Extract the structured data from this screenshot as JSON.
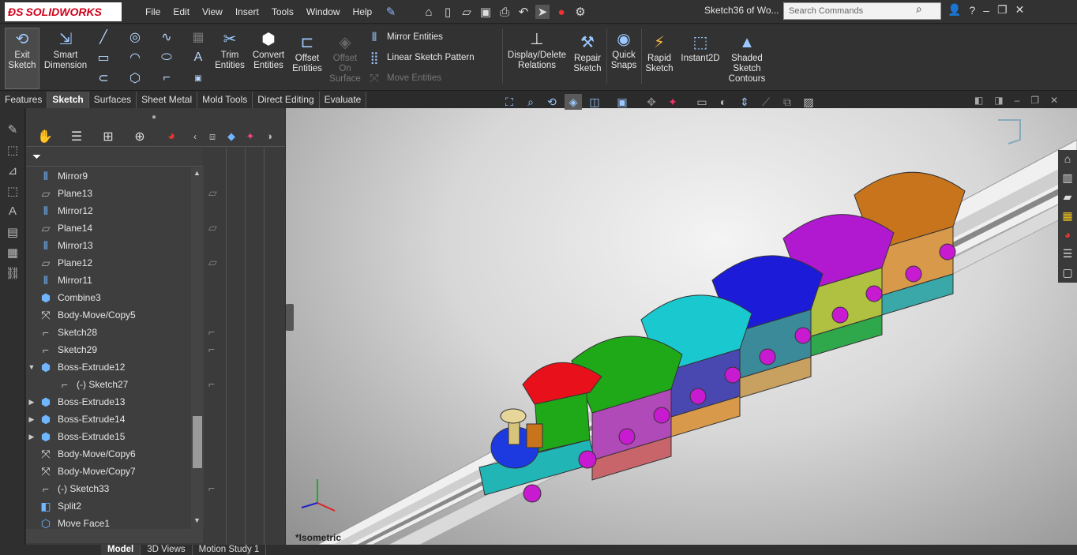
{
  "app": {
    "brand": "SOLIDWORKS",
    "menus": [
      "File",
      "Edit",
      "View",
      "Insert",
      "Tools",
      "Window",
      "Help"
    ],
    "doc_title": "Sketch36 of Wo...",
    "search_placeholder": "Search Commands"
  },
  "commands": {
    "exit_sketch": "Exit Sketch",
    "smart_dimension": "Smart Dimension",
    "trim_entities": "Trim Entities",
    "convert_entities": "Convert Entities",
    "offset_entities": "Offset Entities",
    "offset_on_surface": "Offset On Surface",
    "mirror_entities": "Mirror Entities",
    "linear_sketch_pattern": "Linear Sketch Pattern",
    "move_entities": "Move Entities",
    "display_delete_relations": "Display/Delete Relations",
    "repair_sketch": "Repair Sketch",
    "quick_snaps": "Quick Snaps",
    "rapid_sketch": "Rapid Sketch",
    "instant2d": "Instant2D",
    "shaded_sketch_contours": "Shaded Sketch Contours"
  },
  "tabs": [
    "Features",
    "Sketch",
    "Surfaces",
    "Sheet Metal",
    "Mold Tools",
    "Direct Editing",
    "Evaluate"
  ],
  "active_tab": "Sketch",
  "tree": [
    {
      "label": "Mirror9",
      "icon": "mirror-icon",
      "expand": ""
    },
    {
      "label": "Plane13",
      "icon": "plane-icon",
      "expand": ""
    },
    {
      "label": "Mirror12",
      "icon": "mirror-icon",
      "expand": ""
    },
    {
      "label": "Plane14",
      "icon": "plane-icon",
      "expand": ""
    },
    {
      "label": "Mirror13",
      "icon": "mirror-icon",
      "expand": ""
    },
    {
      "label": "Plane12",
      "icon": "plane-icon",
      "expand": ""
    },
    {
      "label": "Mirror11",
      "icon": "mirror-icon",
      "expand": ""
    },
    {
      "label": "Combine3",
      "icon": "combine-icon",
      "expand": ""
    },
    {
      "label": "Body-Move/Copy5",
      "icon": "move-body-icon",
      "expand": ""
    },
    {
      "label": "Sketch28",
      "icon": "sketch-icon",
      "expand": ""
    },
    {
      "label": "Sketch29",
      "icon": "sketch-icon",
      "expand": ""
    },
    {
      "label": "Boss-Extrude12",
      "icon": "extrude-icon",
      "expand": "▼"
    },
    {
      "label": "(-) Sketch27",
      "icon": "sketch-icon",
      "expand": "",
      "child": true
    },
    {
      "label": "Boss-Extrude13",
      "icon": "extrude-icon",
      "expand": "▶"
    },
    {
      "label": "Boss-Extrude14",
      "icon": "extrude-icon",
      "expand": "▶"
    },
    {
      "label": "Boss-Extrude15",
      "icon": "extrude-icon",
      "expand": "▶"
    },
    {
      "label": "Body-Move/Copy6",
      "icon": "move-body-icon",
      "expand": ""
    },
    {
      "label": "Body-Move/Copy7",
      "icon": "move-body-icon",
      "expand": ""
    },
    {
      "label": "(-) Sketch33",
      "icon": "sketch-icon",
      "expand": ""
    },
    {
      "label": "Split2",
      "icon": "split-icon",
      "expand": ""
    },
    {
      "label": "Move Face1",
      "icon": "move-face-icon",
      "expand": ""
    }
  ],
  "bottom_tabs": [
    "Model",
    "3D Views",
    "Motion Study 1"
  ],
  "active_bottom_tab": "Model",
  "view_label": "*Isometric",
  "colors": {
    "engine_roof": "#e8101a",
    "car_roofs": [
      "#1fa818",
      "#19c9cf",
      "#1c1cd8",
      "#b019d0",
      "#c7741d"
    ],
    "wheels": "#c81ad0",
    "track": "#e8e8e8"
  }
}
